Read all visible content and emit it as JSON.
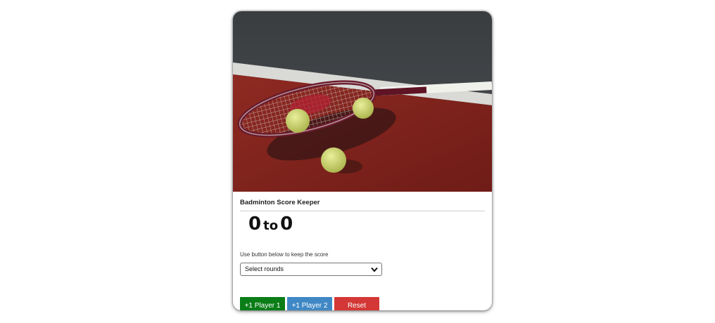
{
  "card": {
    "image_alt": "Tennis racket and balls on court",
    "title": "Badminton Score Keeper",
    "score": {
      "player1": "0",
      "separator": "to",
      "player2": "0"
    },
    "hint": "Use button below to keep the score",
    "rounds_select": {
      "selected": "Select rounds"
    },
    "buttons": {
      "player1": "+1 Player 1",
      "player2": "+1 Player 2",
      "reset": "Reset"
    },
    "colors": {
      "player1_button": "#0a7d17",
      "player2_button": "#3f88c5",
      "reset_button": "#d33836"
    }
  }
}
